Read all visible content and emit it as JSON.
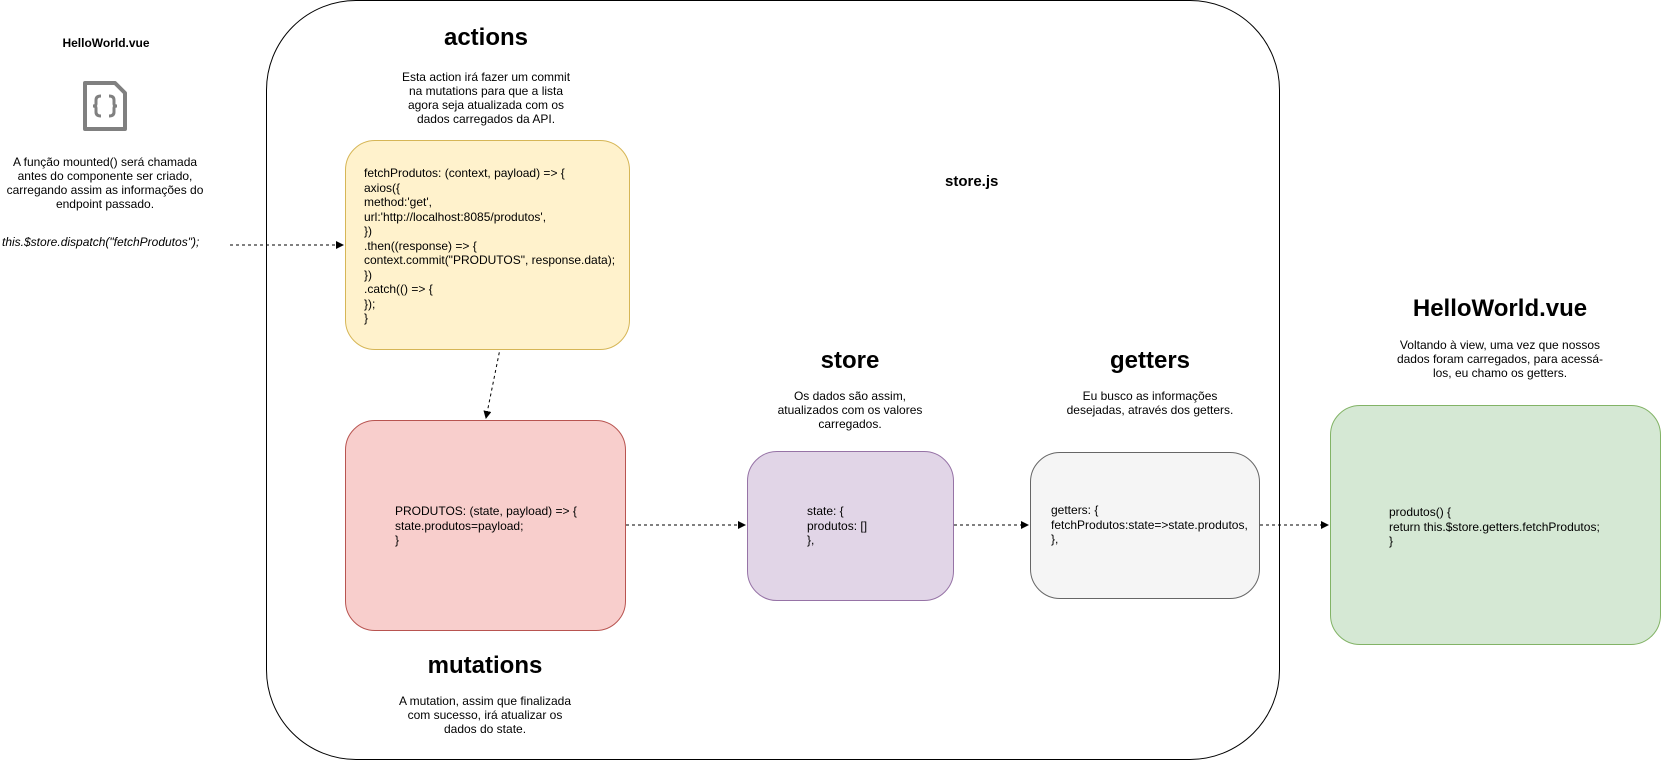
{
  "left": {
    "filename": "HelloWorld.vue",
    "icon": "file-code-icon",
    "description": [
      "A função mounted() será chamada",
      "antes do componente ser criado,",
      "carregando assim as informações do",
      "endpoint passado."
    ],
    "dispatch": "this.$store.dispatch(\"fetchProdutos\");"
  },
  "store_js": {
    "label": "store.js"
  },
  "actions": {
    "title": "actions",
    "description": [
      "Esta action irá fazer um commit",
      "na mutations para que a lista",
      "agora seja atualizada com os",
      "dados carregados da API."
    ],
    "code": [
      "fetchProdutos: (context, payload) => {",
      "axios({",
      "method:'get',",
      "url:'http://localhost:8085/produtos',",
      "})",
      ".then((response) => {",
      "context.commit(\"PRODUTOS\", response.data);",
      "})",
      ".catch(() => {",
      "});",
      "}"
    ],
    "fill": "#fff2cc",
    "stroke": "#d6b656"
  },
  "mutations": {
    "title": "mutations",
    "description": [
      "A mutation, assim que finalizada",
      "com sucesso, irá atualizar os",
      "dados do state."
    ],
    "code": [
      "PRODUTOS: (state, payload) => {",
      "state.produtos=payload;",
      "}"
    ],
    "fill": "#f8cecc",
    "stroke": "#b85450"
  },
  "store": {
    "title": "store",
    "description": [
      "Os dados são assim,",
      "atualizados com os valores",
      "carregados."
    ],
    "code": [
      "state: {",
      "produtos: []",
      "},"
    ],
    "fill": "#e1d5e7",
    "stroke": "#9673a6"
  },
  "getters": {
    "title": "getters",
    "description": [
      "Eu busco as informações",
      "desejadas, através dos getters."
    ],
    "code": [
      "getters: {",
      "fetchProdutos:state=>state.produtos,",
      "},"
    ],
    "fill": "#f5f5f5",
    "stroke": "#666666"
  },
  "right": {
    "title": "HelloWorld.vue",
    "description": [
      "Voltando à view, uma vez que nossos",
      "dados foram carregados, para acessá-",
      "los, eu chamo os getters."
    ],
    "code": [
      "produtos() {",
      "return this.$store.getters.fetchProdutos;",
      "}"
    ],
    "fill": "#d5e8d4",
    "stroke": "#82b366"
  }
}
